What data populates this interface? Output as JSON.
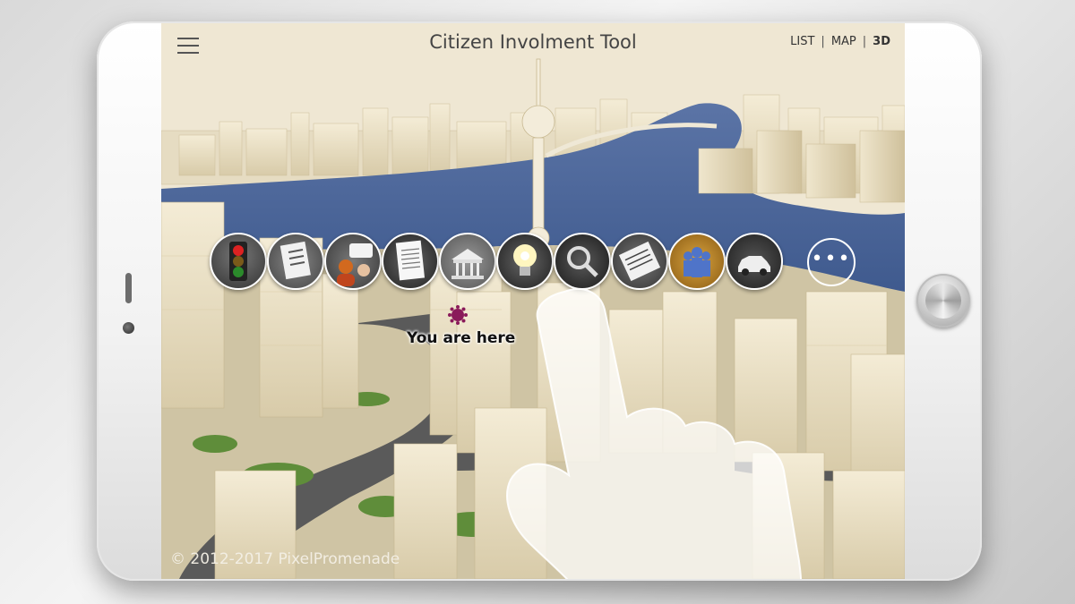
{
  "app": {
    "title": "Citizen Involment Tool"
  },
  "views": {
    "list": "LIST",
    "sep1": "|",
    "map": "MAP",
    "sep2": "|",
    "threed": "3D",
    "active": "3D"
  },
  "toolbar": {
    "tools": [
      {
        "icon": "traffic-light-icon"
      },
      {
        "icon": "checklist-icon"
      },
      {
        "icon": "discussion-icon"
      },
      {
        "icon": "document-icon"
      },
      {
        "icon": "public-building-icon"
      },
      {
        "icon": "idea-bulb-icon"
      },
      {
        "icon": "search-magnifier-icon"
      },
      {
        "icon": "newspaper-icon"
      },
      {
        "icon": "community-people-icon"
      },
      {
        "icon": "car-icon"
      }
    ],
    "more_label": "•••"
  },
  "map": {
    "location_label": "You are here",
    "copyright": "© 2012-2017 PixelPromenade"
  },
  "colors": {
    "accent_marker": "#8a1a5a",
    "water": "#4e6a9a"
  }
}
